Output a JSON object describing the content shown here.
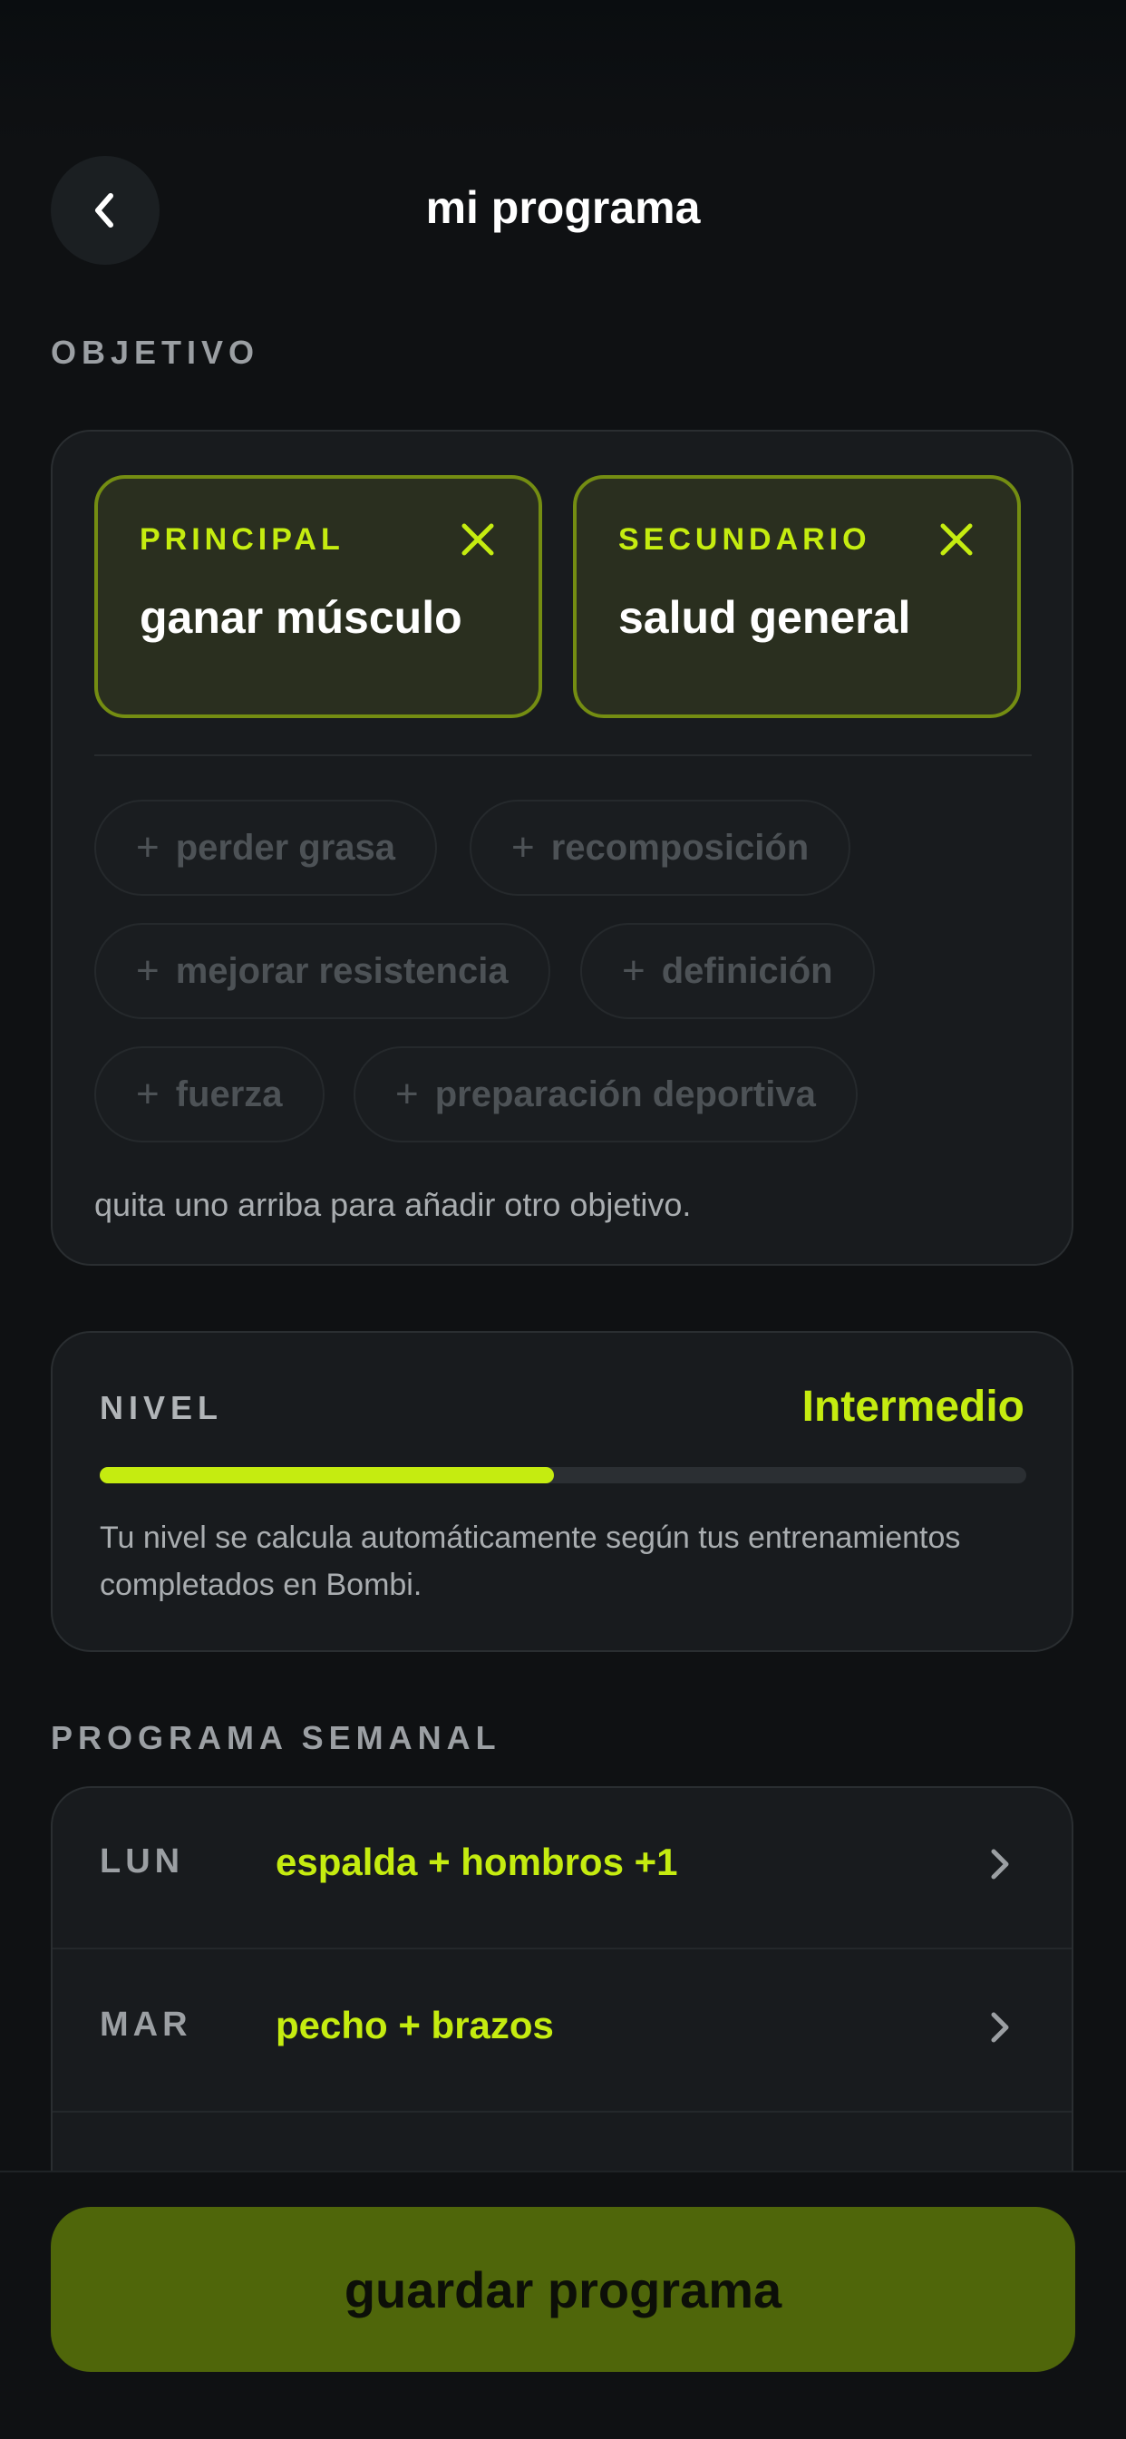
{
  "header": {
    "title": "mi programa",
    "back_icon": "chevron-left-icon"
  },
  "objetivo": {
    "section_label": "OBJETIVO",
    "principal": {
      "kicker": "PRINCIPAL",
      "value": "ganar músculo"
    },
    "secundario": {
      "kicker": "SECUNDARIO",
      "value": "salud general"
    },
    "options": [
      "perder grasa",
      "recomposición",
      "mejorar resistencia",
      "definición",
      "fuerza",
      "preparación deportiva"
    ],
    "helper": "quita uno arriba para añadir otro objetivo."
  },
  "nivel": {
    "label": "NIVEL",
    "value": "Intermedio",
    "progress": 0.49,
    "description": "Tu nivel se calcula automáticamente según tus entrenamientos completados en Bombi."
  },
  "programa": {
    "section_label": "PROGRAMA SEMANAL",
    "days": [
      {
        "day": "LUN",
        "routine": "espalda + hombros +1"
      },
      {
        "day": "MAR",
        "routine": "pecho + brazos"
      }
    ]
  },
  "footer": {
    "save_label": "guardar programa"
  },
  "colors": {
    "accent": "#c5ec10",
    "background": "#0f1113",
    "card": "#181b1e",
    "save_button": "#4f660a"
  }
}
